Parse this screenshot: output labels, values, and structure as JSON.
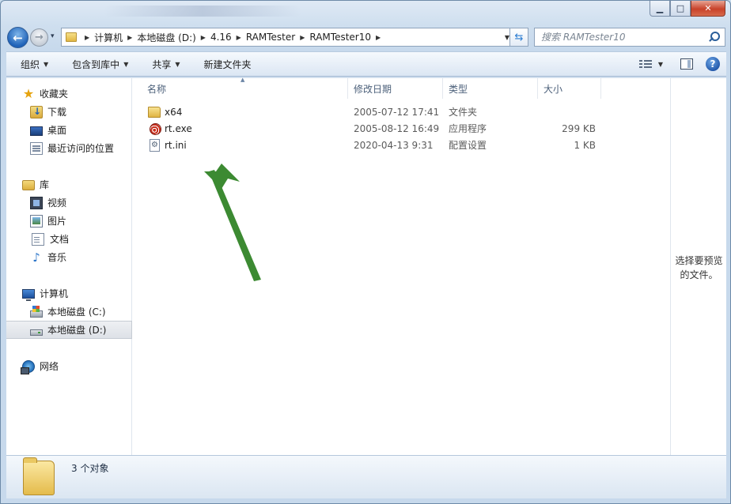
{
  "window": {
    "caption": {
      "minimize": "▁",
      "maximize": "□",
      "close": "✕"
    }
  },
  "nav": {
    "back_glyph": "←",
    "forward_glyph": "→",
    "recent_glyph": "▾",
    "breadcrumbs": [
      "计算机",
      "本地磁盘 (D:)",
      "4.16",
      "RAMTester",
      "RAMTester10"
    ],
    "separator": "▶",
    "dropdown_glyph": "▼",
    "refresh_glyph": "⇆",
    "search_placeholder": "搜索 RAMTester10"
  },
  "toolbar": {
    "organize": "组织",
    "include_in_library": "包含到库中",
    "share": "共享",
    "new_folder": "新建文件夹",
    "dropdown_glyph": "▼",
    "help_glyph": "?"
  },
  "sidebar": {
    "favorites": {
      "label": "收藏夹",
      "items": [
        "下载",
        "桌面",
        "最近访问的位置"
      ]
    },
    "libraries": {
      "label": "库",
      "items": [
        "视频",
        "图片",
        "文档",
        "音乐"
      ]
    },
    "computer": {
      "label": "计算机",
      "items": [
        "本地磁盘 (C:)",
        "本地磁盘 (D:)"
      ],
      "selected": "本地磁盘 (D:)"
    },
    "network": {
      "label": "网络"
    }
  },
  "file_list": {
    "columns": [
      "名称",
      "修改日期",
      "类型",
      "大小"
    ],
    "sort_glyph": "▲",
    "rows": [
      {
        "name": "x64",
        "date": "2005-07-12 17:41",
        "type": "文件夹",
        "size": "",
        "icon": "folder-icon"
      },
      {
        "name": "rt.exe",
        "date": "2005-08-12 16:49",
        "type": "应用程序",
        "size": "299 KB",
        "icon": "exe-icon"
      },
      {
        "name": "rt.ini",
        "date": "2020-04-13 9:31",
        "type": "配置设置",
        "size": "1 KB",
        "icon": "ini-file-icon"
      }
    ]
  },
  "annotation": {
    "arrow_color": "#3c8a32"
  },
  "preview": {
    "line1": "选择要预览",
    "line2": "的文件。"
  },
  "details": {
    "item_count": "3 个对象"
  }
}
